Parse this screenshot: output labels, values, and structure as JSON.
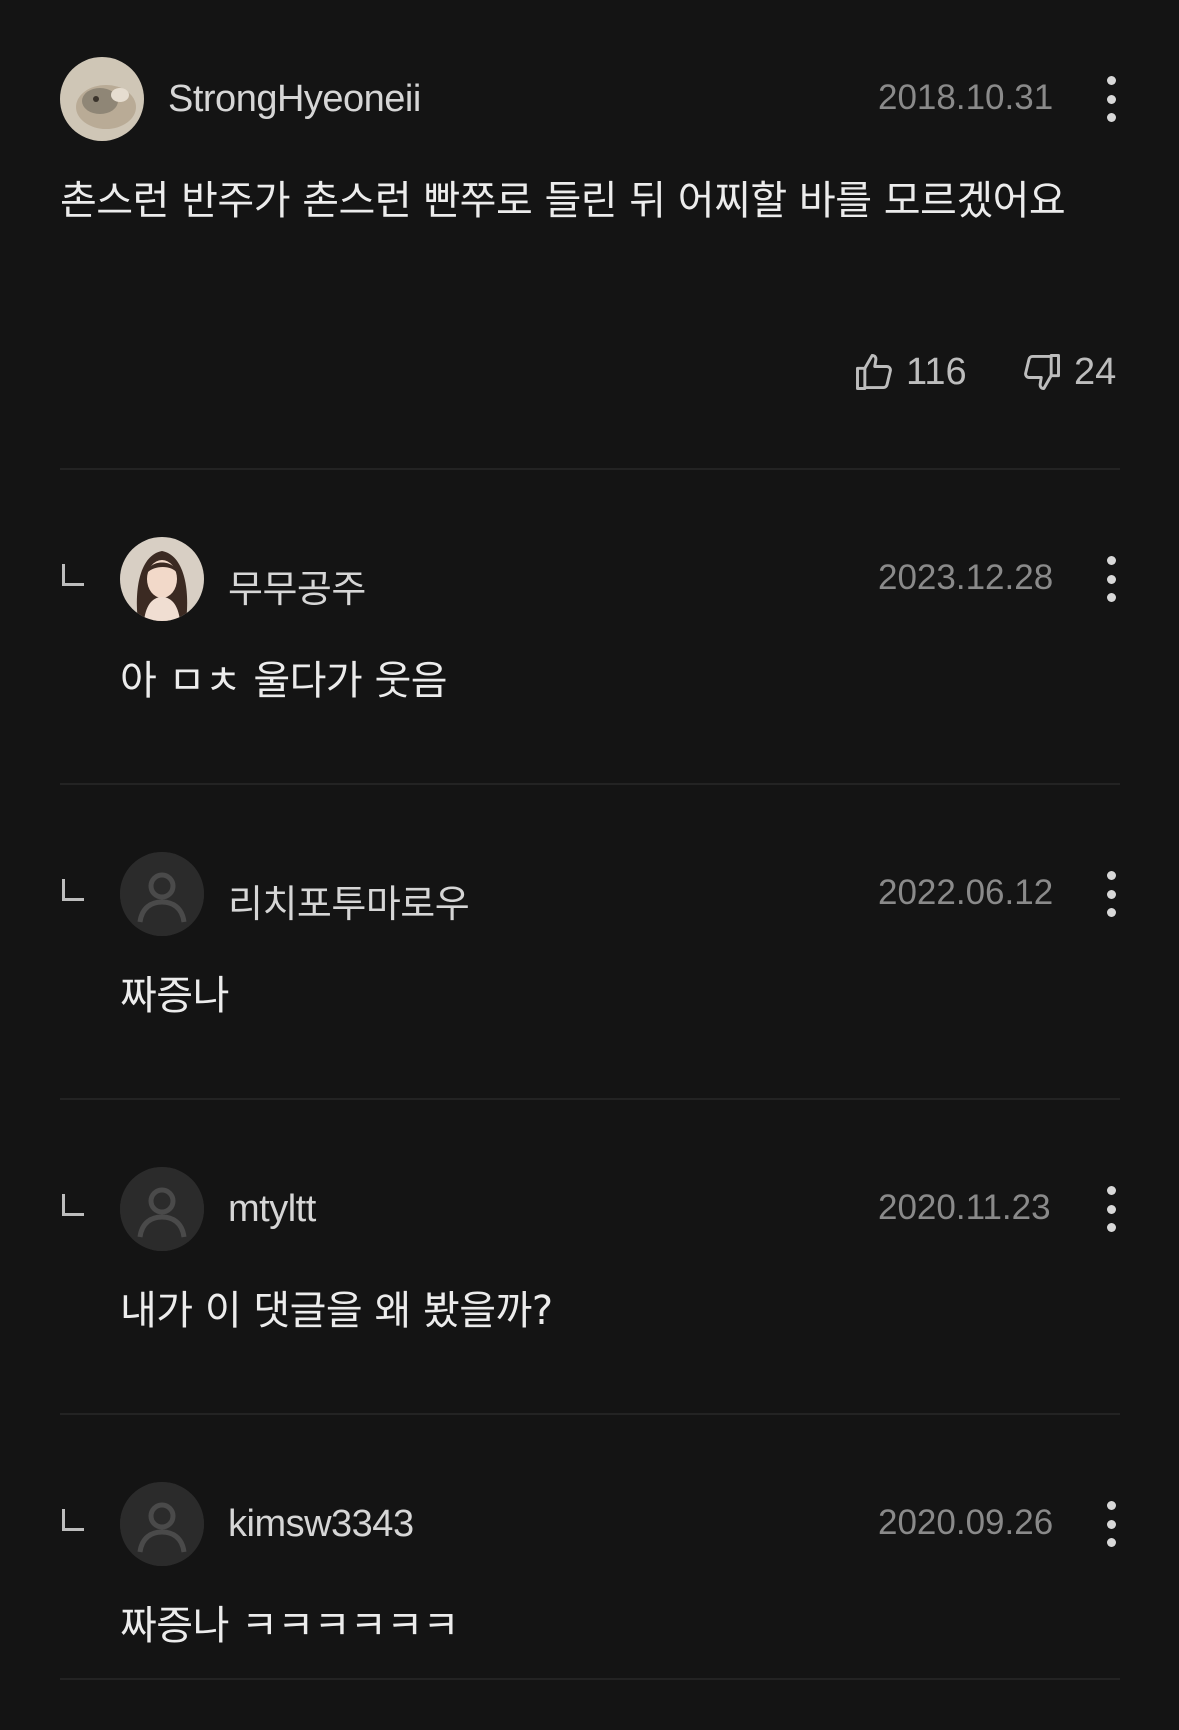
{
  "main_comment": {
    "username": "StrongHyeoneii",
    "date": "2018.10.31",
    "text": "촌스런 반주가 촌스런 빤쭈로 들린 뒤 어찌할 바를 모르겠어요",
    "likes": "116",
    "dislikes": "24",
    "avatar_icon": "hamster-photo-avatar"
  },
  "replies": [
    {
      "username": "무무공주",
      "date": "2023.12.28",
      "text": "아 ㅁㅊ 울다가 웃음",
      "avatar_icon": "profile-photo-avatar"
    },
    {
      "username": "리치포투마로우",
      "date": "2022.06.12",
      "text": "짜증나",
      "avatar_icon": "default-user-icon"
    },
    {
      "username": "mtyltt",
      "date": "2020.11.23",
      "text": "내가 이 댓글을 왜 봤을까?",
      "avatar_icon": "default-user-icon"
    },
    {
      "username": "kimsw3343",
      "date": "2020.09.26",
      "text": "짜증나 ㅋㅋㅋㅋㅋㅋ",
      "avatar_icon": "default-user-icon"
    }
  ],
  "colors": {
    "background": "#141414",
    "text": "#ececec",
    "muted": "#8a8a8a",
    "divider": "#232323"
  }
}
